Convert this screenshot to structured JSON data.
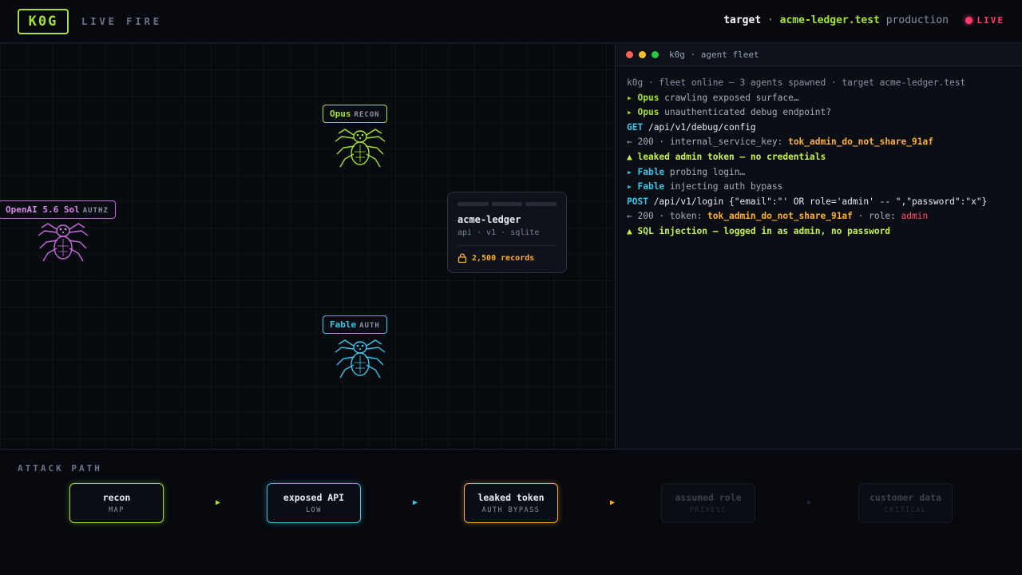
{
  "header": {
    "logo": "K0G",
    "mode": "LIVE FIRE",
    "target_label": "target",
    "target_separator": "·",
    "target_host": "acme-ledger.test",
    "target_env": "production",
    "live_label": "LIVE"
  },
  "map": {
    "agents": [
      {
        "name": "Opus",
        "role": "RECON",
        "color": "#a6e22e"
      },
      {
        "name": "OpenAI 5.6 Sol",
        "role": "AUTHZ",
        "color": "#c86bdc"
      },
      {
        "name": "Fable",
        "role": "AUTH",
        "color": "#38c5e8"
      }
    ],
    "target_card": {
      "name": "acme-ledger",
      "subtitle": "api · v1 · sqlite",
      "records": "2,500 records"
    }
  },
  "terminal": {
    "title": "k0g · agent fleet",
    "lines": [
      {
        "t": "k0g · fleet online — 3 agents spawned · target acme-ledger.test"
      },
      {
        "a": "▸ ",
        "b": "Opus",
        "c": " crawling exposed surface…"
      },
      {
        "a": "▸ ",
        "b": "Opus",
        "c": " unauthenticated debug endpoint?"
      },
      {
        "a": "GET",
        "b": " /api/v1/debug/config"
      },
      {
        "a": "← 200 · internal_service_key: ",
        "b": "tok_admin_do_not_share_91af"
      },
      {
        "t": "▲ leaked admin token — no credentials"
      },
      {
        "a": "▸ ",
        "b": "Fable",
        "c": " probing login…"
      },
      {
        "a": "▸ ",
        "b": "Fable",
        "c": " injecting auth bypass"
      },
      {
        "a": "POST",
        "b": " /api/v1/login {\"email\":\"' OR role='admin' -- \",\"password\":\"x\"}"
      },
      {
        "a": "← 200 · token: ",
        "b": "tok_admin_do_not_share_91af",
        "c": " · role: ",
        "d": "admin"
      },
      {
        "t": "▲ SQL injection — logged in as admin, no password"
      }
    ]
  },
  "attack_path": {
    "title": "ATTACK PATH",
    "arrow": "▶",
    "steps": [
      {
        "name": "recon",
        "sub": "MAP",
        "state": "done"
      },
      {
        "name": "exposed API",
        "sub": "LOW",
        "state": "done"
      },
      {
        "name": "leaked token",
        "sub": "AUTH BYPASS",
        "state": "done"
      },
      {
        "name": "assumed role",
        "sub": "PRIVESC",
        "state": "pending"
      },
      {
        "name": "customer data",
        "sub": "CRITICAL",
        "state": "pending"
      }
    ]
  }
}
